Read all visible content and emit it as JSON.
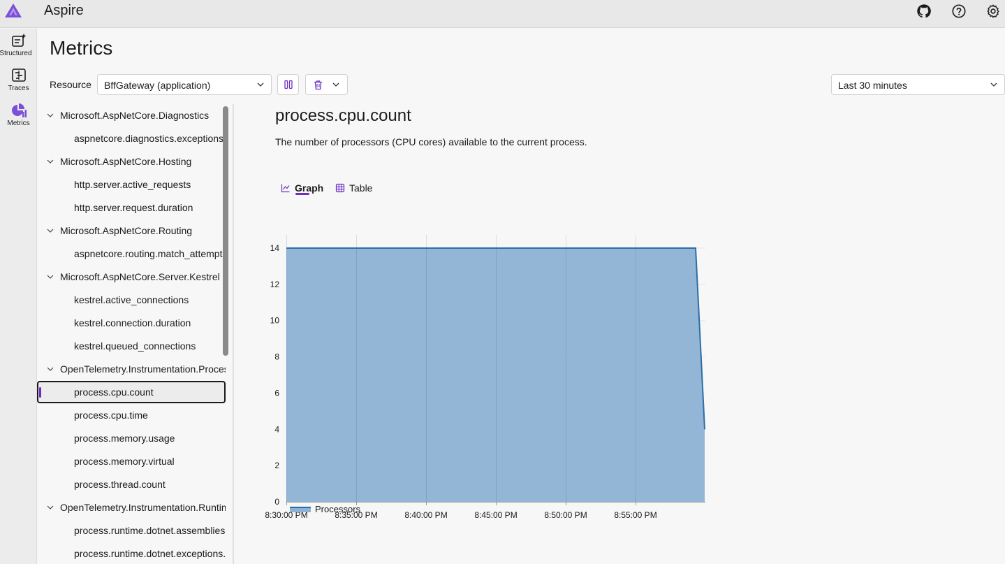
{
  "app": {
    "title": "Aspire"
  },
  "nav": [
    {
      "label": "Structured",
      "icon": "structured-logs-icon"
    },
    {
      "label": "Traces",
      "icon": "traces-icon"
    },
    {
      "label": "Metrics",
      "icon": "metrics-icon"
    }
  ],
  "page": {
    "title": "Metrics"
  },
  "toolbar": {
    "resource_label": "Resource",
    "resource_value": "BffGateway (application)",
    "time_range": "Last 30 minutes"
  },
  "tree": [
    {
      "type": "group",
      "label": "Microsoft.AspNetCore.Diagnostics"
    },
    {
      "type": "leaf",
      "label": "aspnetcore.diagnostics.exceptions"
    },
    {
      "type": "group",
      "label": "Microsoft.AspNetCore.Hosting"
    },
    {
      "type": "leaf",
      "label": "http.server.active_requests"
    },
    {
      "type": "leaf",
      "label": "http.server.request.duration"
    },
    {
      "type": "group",
      "label": "Microsoft.AspNetCore.Routing"
    },
    {
      "type": "leaf",
      "label": "aspnetcore.routing.match_attempts"
    },
    {
      "type": "group",
      "label": "Microsoft.AspNetCore.Server.Kestrel"
    },
    {
      "type": "leaf",
      "label": "kestrel.active_connections"
    },
    {
      "type": "leaf",
      "label": "kestrel.connection.duration"
    },
    {
      "type": "leaf",
      "label": "kestrel.queued_connections"
    },
    {
      "type": "group",
      "label": "OpenTelemetry.Instrumentation.Process"
    },
    {
      "type": "leaf",
      "label": "process.cpu.count",
      "selected": true
    },
    {
      "type": "leaf",
      "label": "process.cpu.time"
    },
    {
      "type": "leaf",
      "label": "process.memory.usage"
    },
    {
      "type": "leaf",
      "label": "process.memory.virtual"
    },
    {
      "type": "leaf",
      "label": "process.thread.count"
    },
    {
      "type": "group",
      "label": "OpenTelemetry.Instrumentation.Runtime"
    },
    {
      "type": "leaf",
      "label": "process.runtime.dotnet.assemblies.count"
    },
    {
      "type": "leaf",
      "label": "process.runtime.dotnet.exceptions.count"
    }
  ],
  "metric": {
    "title": "process.cpu.count",
    "description": "The number of processors (CPU cores) available to the current process.",
    "tabs": {
      "graph": "Graph",
      "table": "Table"
    }
  },
  "colors": {
    "accent": "#6b2ec6",
    "series_fill": "#8db2d5",
    "series_line": "#2c6ea8"
  },
  "chart_data": {
    "type": "area",
    "x": [
      "8:30:00 PM",
      "8:35:00 PM",
      "8:40:00 PM",
      "8:45:00 PM",
      "8:50:00 PM",
      "8:55:00 PM"
    ],
    "x_minutes": [
      0,
      5,
      10,
      15,
      20,
      25
    ],
    "series": [
      {
        "name": "Processors",
        "points": [
          [
            0,
            14
          ],
          [
            29.3,
            14
          ],
          [
            29.95,
            4
          ]
        ]
      }
    ],
    "xlim": [
      0,
      30
    ],
    "ylim": [
      0,
      14
    ],
    "yticks": [
      0,
      2,
      4,
      6,
      8,
      10,
      12,
      14
    ],
    "grid": true,
    "legend": "bottom-left"
  }
}
